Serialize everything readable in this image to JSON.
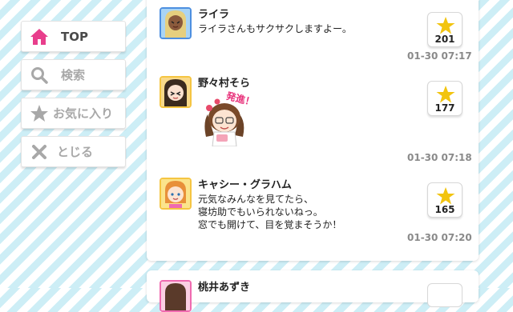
{
  "nav": {
    "top_label": "TOP",
    "search_label": "検索",
    "favorites_label": "お気に入り",
    "close_label": "とじる"
  },
  "colors": {
    "accent_pink": "#e83e8c",
    "star_yellow": "#f2c40f",
    "inactive_icon": "#a8a8a8"
  },
  "posts": [
    {
      "name": "ライラ",
      "message": "ライラさんもサクサクしますよー。",
      "stars": "201",
      "timestamp": "01-30 07:17"
    },
    {
      "name": "野々村そら",
      "message": "",
      "sticker_text": "発進！",
      "stars": "177",
      "timestamp": "01-30 07:18"
    },
    {
      "name": "キャシー・グラハム",
      "message": "元気なみんなを見てたら、\n寝坊助でもいられないねっ。\n窓でも開けて、目を覚まそうか！",
      "stars": "165",
      "timestamp": "01-30 07:20"
    },
    {
      "name": "桃井あずき"
    }
  ]
}
